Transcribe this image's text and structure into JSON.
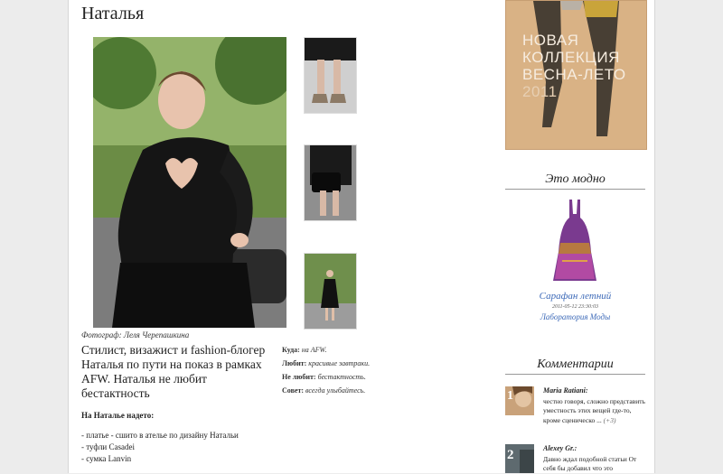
{
  "article": {
    "title": "Наталья",
    "photo_credit": "Фотограф: Леля Черепашкина",
    "lead": "Стилист, визажист и fashion-блогер Наталья по пути на показ в рамках AFW. Наталья не любит бестактность",
    "facts": [
      {
        "label": "Куда:",
        "value": "на AFW."
      },
      {
        "label": "Любит:",
        "value": "красивые завтраки."
      },
      {
        "label": "Не любит:",
        "value": "бестактность."
      },
      {
        "label": "Совет:",
        "value": "всегда улыбайтесь."
      }
    ],
    "wearing_title": "На Наталье надето:",
    "wearing": [
      "- платье - сшито в ателье по дизайну Натальи",
      "- туфли Casadei",
      "- сумка Lanvin"
    ]
  },
  "promo": {
    "lines": [
      "НОВАЯ",
      "КОЛЛЕКЦИЯ",
      "ВЕСНА-ЛЕТО",
      "2011"
    ]
  },
  "fashion": {
    "heading": "Это модно",
    "product_name": "Сарафан летний",
    "product_date": "2011-05-12 23:30:03",
    "product_shop": "Лаборатория Моды"
  },
  "comments": {
    "heading": "Комментарии",
    "items": [
      {
        "avatar_num": "1",
        "author": "Maria Ratiani:",
        "text": "честно говоря, сложно представить уместность этих вещей где-то, кроме сценическо ...",
        "count": "(+3)"
      },
      {
        "avatar_num": "2",
        "author": "Alexey Gr.:",
        "text": "Давно ждал подобной статьи От себя бы добавил что это",
        "count": ""
      }
    ]
  },
  "colors": {
    "page_bg": "#ffffff",
    "outer_bg": "#ececec",
    "link": "#3d6ab8",
    "promo_bg": "#d9b285"
  }
}
